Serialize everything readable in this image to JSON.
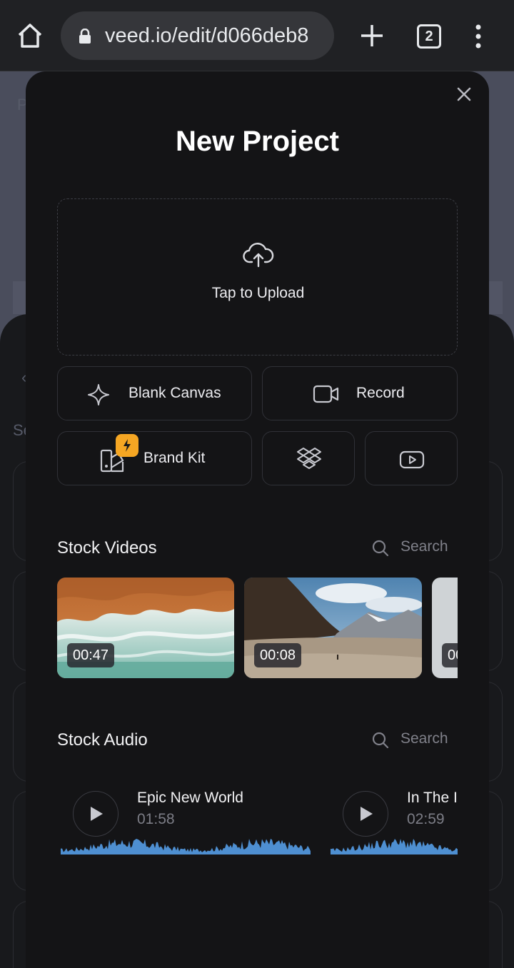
{
  "browser": {
    "url": "veed.io/edit/d066deb8",
    "tab_count": "2"
  },
  "background": {
    "letter_p": "P",
    "letter_se": "Se",
    "letter_arrow": "‹"
  },
  "modal": {
    "title": "New Project",
    "upload_label": "Tap to Upload",
    "buttons": {
      "blank_canvas": "Blank Canvas",
      "record": "Record",
      "brand_kit": "Brand Kit"
    },
    "stock_videos": {
      "title": "Stock Videos",
      "search_placeholder": "Search",
      "items": [
        {
          "duration": "00:47"
        },
        {
          "duration": "00:08"
        },
        {
          "duration": "00"
        }
      ]
    },
    "stock_audio": {
      "title": "Stock Audio",
      "search_placeholder": "Search",
      "items": [
        {
          "name": "Epic New World",
          "time": "01:58"
        },
        {
          "name": "In The I",
          "time": "02:59"
        }
      ]
    }
  },
  "colors": {
    "accent_orange": "#f5a623",
    "waveform": "#4e8fd1",
    "modal_bg": "#141416"
  },
  "icons": [
    "home-icon",
    "lock-icon",
    "plus-icon",
    "tab-switcher-icon",
    "more-vert-icon",
    "close-icon",
    "cloud-upload-icon",
    "sparkle-icon",
    "video-camera-icon",
    "brand-kit-icon",
    "lightning-icon",
    "dropbox-icon",
    "youtube-icon",
    "search-icon",
    "play-icon"
  ]
}
